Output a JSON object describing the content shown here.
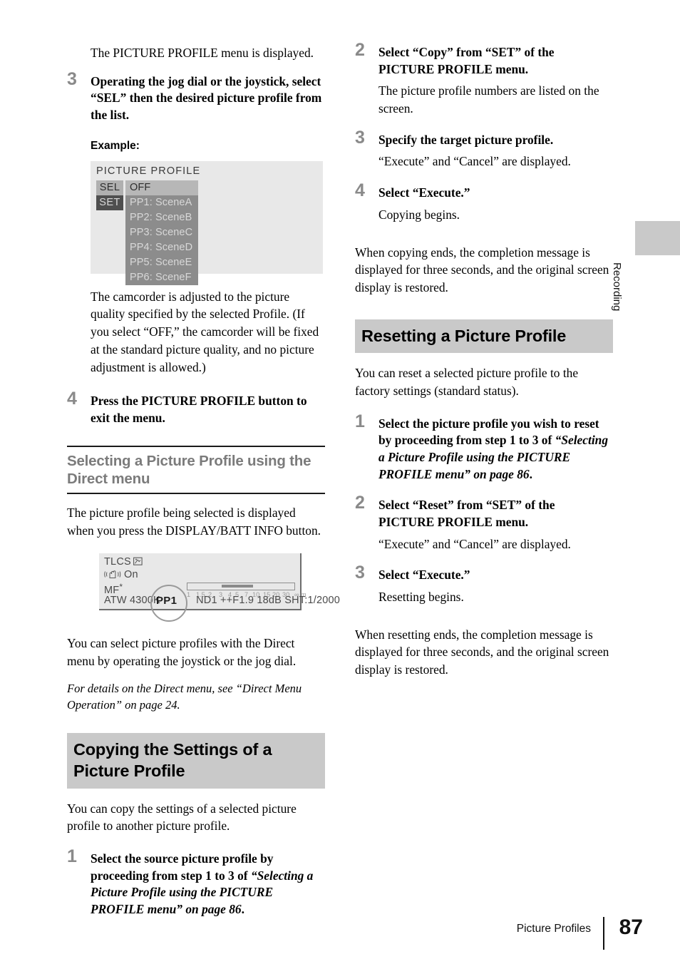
{
  "left_column": {
    "intro_text": "The PICTURE PROFILE menu is displayed.",
    "step3": {
      "num": "3",
      "text": "Operating the jog dial or the joystick, select “SEL” then the desired picture profile from the list."
    },
    "example_label": "Example:",
    "menu_figure": {
      "title": "PICTURE PROFILE",
      "tabs": [
        "SEL",
        "SET"
      ],
      "items": [
        "OFF",
        "PP1: SceneA",
        "PP2: SceneB",
        "PP3: SceneC",
        "PP4: SceneD",
        "PP5: SceneE",
        "PP6: SceneF"
      ],
      "highlighted_item": "OFF"
    },
    "after_menu_text": "The camcorder is adjusted to the picture quality specified by the selected Profile. (If you select “OFF,” the camcorder will be fixed at the standard picture quality, and no picture adjustment is allowed.)",
    "step4": {
      "num": "4",
      "text": "Press the PICTURE PROFILE button to exit the menu."
    },
    "subheading_direct_menu": "Selecting a Picture Profile using the Direct menu",
    "direct_menu_text": "The picture profile being selected is displayed when you press the DISPLAY/BATT INFO button.",
    "display_figure": {
      "line1_label": "TLCS",
      "line1_icon": "backlight-icon",
      "line2_icon": "steadyshot-icon",
      "line2_label": "On",
      "line3_label": "MF",
      "line3_superscript": "*",
      "focus_scale": [
        "1",
        "1.5",
        "2",
        "3",
        "4",
        "5",
        "7",
        "10",
        "15",
        "20",
        "30",
        "∞",
        "m"
      ],
      "status_line_before": "ATW 4300K",
      "status_line_circled": "PP1",
      "status_line_after": "ND1 ++F1.9  18dB SHT:1/2000"
    },
    "direct_menu_text2": "You can select picture profiles with the Direct menu by operating the joystick or the jog dial.",
    "direct_menu_note": "For details on the Direct menu, see “Direct Menu Operation” on page 24.",
    "heading_copying": "Copying the Settings of a Picture Profile",
    "copying_intro": "You can copy the settings of a selected picture profile to another picture profile.",
    "copy_step1": {
      "num": "1",
      "text_plain_a": "Select the source picture profile by proceeding from step 1 to 3 of ",
      "text_italic": "“Selecting a Picture Profile using the PICTURE PROFILE menu” on page 86",
      "text_plain_b": "."
    }
  },
  "right_column": {
    "copy_step2": {
      "num": "2",
      "text": "Select “Copy” from “SET” of the PICTURE PROFILE menu.",
      "sub": "The picture profile numbers are listed on the screen."
    },
    "copy_step3": {
      "num": "3",
      "text": "Specify the target picture profile.",
      "sub": "“Execute” and “Cancel” are displayed."
    },
    "copy_step4": {
      "num": "4",
      "text": "Select “Execute.”",
      "sub": "Copying begins."
    },
    "copy_closing": "When copying ends, the completion message is displayed for three seconds, and the original screen display is restored.",
    "heading_resetting": "Resetting a Picture Profile",
    "reset_intro": "You can reset a selected picture profile to the factory settings (standard status).",
    "reset_step1": {
      "num": "1",
      "text_plain_a": "Select the picture profile you wish to reset by proceeding from step 1 to 3 of ",
      "text_italic": "“Selecting a Picture Profile using the PICTURE PROFILE menu” on page 86",
      "text_plain_b": "."
    },
    "reset_step2": {
      "num": "2",
      "text": "Select “Reset” from “SET” of the PICTURE PROFILE menu.",
      "sub": "“Execute” and “Cancel” are displayed."
    },
    "reset_step3": {
      "num": "3",
      "text": "Select “Execute.”",
      "sub": "Resetting begins."
    },
    "reset_closing": "When resetting ends, the completion message is displayed for three seconds, and the original screen display is restored."
  },
  "side_tab": {
    "label": "Recording"
  },
  "footer": {
    "section_title": "Picture Profiles",
    "page_number": "87"
  },
  "colors": {
    "heading_bg": "#c9c9c9",
    "subheading_text": "#7b7b7b",
    "step_number": "#8a8a8a",
    "figure_bg": "#e8e8e8",
    "menu_list_bg": "#8c8c8c"
  }
}
